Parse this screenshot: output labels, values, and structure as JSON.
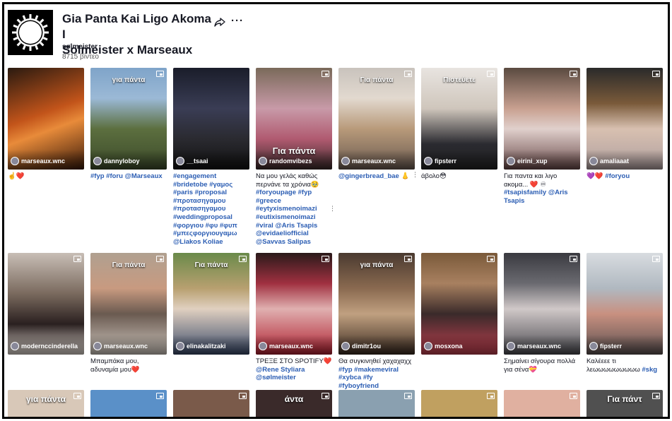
{
  "playlist": {
    "title": "Gia Panta Kai Ligo Akoma I Solmeister x Marseaux",
    "title_line1": "Gia Panta Kai Ligo Akoma I",
    "title_line2": "Solmeister x Marseaux",
    "creator": "sølmeister",
    "video_count": "8715 βίντεο"
  },
  "icons": {
    "share": "share-icon",
    "more": "more-icon",
    "pip": "picture-in-picture-icon"
  },
  "row1": [
    {
      "user": "marseaux.wnc",
      "overlay": "",
      "caption_parts": [
        {
          "t": "☝️❤️",
          "tag": false
        }
      ]
    },
    {
      "user": "dannyloboy",
      "overlay": "για πάντα",
      "caption_parts": [
        {
          "t": "#fyp #foru @Marseaux",
          "tag": true
        }
      ]
    },
    {
      "user": "__tsaai",
      "overlay": "",
      "caption_parts": [
        {
          "t": "#engagement #bridetobe #γαμος #paris #proposal #προτασηγαμου #προτασηγαμου #weddingproposal #φοργιου #φυ #φυπ #μπεςφοργιουγαμω @Liakos Koliae",
          "tag": true
        }
      ]
    },
    {
      "user": "randomvibezs",
      "overlay": "Για πάντα",
      "caption_parts": [
        {
          "t": "Να μου γελάς καθώς περνάνε τα χρόνια🥹 ",
          "tag": false
        },
        {
          "t": "#foryoupage #fyp #greece #eytyxismenoimazi #eutixismenoimazi #viral @Aris Tsapis @evidaeliofficial @Savvas Salipas",
          "tag": true
        }
      ]
    },
    {
      "user": "marseaux.wnc",
      "overlay": "Για πάντα",
      "caption_parts": [
        {
          "t": "@gingerbread_bae",
          "tag": true
        },
        {
          "t": " 👃",
          "tag": false
        }
      ]
    },
    {
      "user": "fipsterr",
      "overlay": "Πιστεύετε",
      "caption_parts": [
        {
          "t": "άβολο😳",
          "tag": false
        }
      ]
    },
    {
      "user": "eirini_xup",
      "overlay": "",
      "caption_parts": [
        {
          "t": "Για παντα και λιγο ακομα... ❤️ ♾ ",
          "tag": false
        },
        {
          "t": "#tsapisfamily @Aris Tsapis",
          "tag": true
        }
      ]
    },
    {
      "user": "amaliaaat",
      "overlay": "",
      "caption_parts": [
        {
          "t": "💜❤️ ",
          "tag": false
        },
        {
          "t": "#foryou",
          "tag": true
        }
      ]
    }
  ],
  "row2": [
    {
      "user": "modernccinderella",
      "overlay": "",
      "caption_parts": []
    },
    {
      "user": "marseaux.wnc",
      "overlay": "Για πάντα",
      "caption_parts": [
        {
          "t": "Μπαμπάκα μου, αδυναμία μου❤️",
          "tag": false
        }
      ]
    },
    {
      "user": "elinakalitzaki",
      "overlay": "Για πάντα",
      "caption_parts": []
    },
    {
      "user": "marseaux.wnc",
      "overlay": "",
      "caption_parts": [
        {
          "t": "ΤΡΕΞΕ ΣΤΟ SPOTIFY❤️ ",
          "tag": false
        },
        {
          "t": "@Rene Styliara @sølmeister",
          "tag": true
        }
      ]
    },
    {
      "user": "dimitr1ou",
      "overlay": "για πάντα",
      "caption_parts": [
        {
          "t": "Θα συγκινηθεί χαχαχαχχ ",
          "tag": false
        },
        {
          "t": "#fyp #makemeviral #xybca #fy #fyboyfriend",
          "tag": true
        }
      ]
    },
    {
      "user": "mosxona",
      "overlay": "",
      "caption_parts": []
    },
    {
      "user": "marseaux.wnc",
      "overlay": "",
      "caption_parts": [
        {
          "t": "Σημαίνει σίγουρα πολλά για σένα💝",
          "tag": false
        }
      ]
    },
    {
      "user": "fipsterr",
      "overlay": "",
      "caption_parts": [
        {
          "t": "Καλέεεε τι λεωωωωωωωωω ",
          "tag": false
        },
        {
          "t": "#skg",
          "tag": true
        }
      ]
    }
  ],
  "row3_overlays": [
    "για πάντα",
    "",
    "",
    "άντα",
    "",
    "",
    "",
    "Για πάντ"
  ],
  "colors": {
    "link": "#2b5db3",
    "text": "#161823"
  }
}
